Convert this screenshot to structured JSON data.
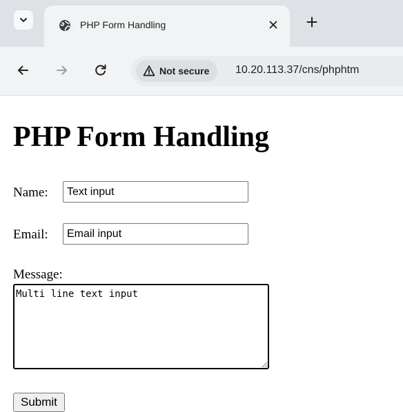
{
  "browser": {
    "tab": {
      "title": "PHP Form Handling",
      "favicon": "globe-icon"
    },
    "tab_controls": {
      "tab_list_icon": "chevron-down-icon",
      "close_icon": "close-icon",
      "new_tab_icon": "plus-icon"
    },
    "toolbar": {
      "back_icon": "arrow-left-icon",
      "forward_icon": "arrow-right-icon",
      "reload_icon": "reload-icon",
      "security_icon": "warning-triangle-icon",
      "security_label": "Not secure",
      "url": "10.20.113.37/cns/phphtm"
    }
  },
  "page": {
    "title": "PHP Form Handling",
    "form": {
      "name_label": "Name:",
      "name_value": "Text input",
      "email_label": "Email:",
      "email_value": "Email input",
      "message_label": "Message:",
      "message_value": "Multi line text input",
      "submit_label": "Submit"
    }
  },
  "colors": {
    "tab_strip_bg": "#dee1e6",
    "toolbar_bg": "#f1f3f4",
    "omnibox_bg": "#e9ebee",
    "page_bg": "#ffffff"
  }
}
